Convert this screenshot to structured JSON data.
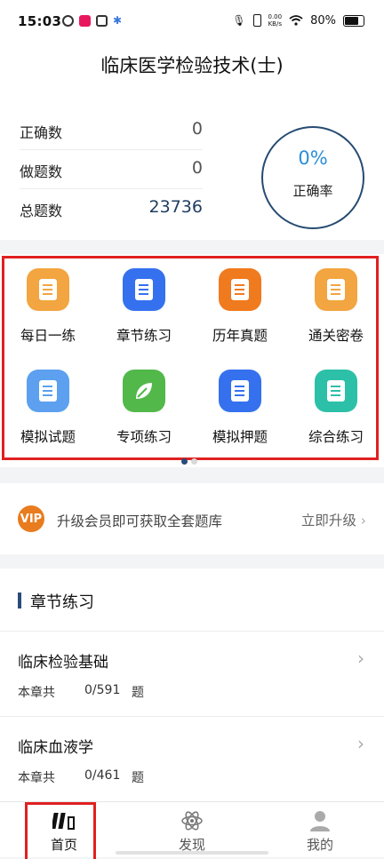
{
  "status_bar": {
    "time": "15:03",
    "net_speed_value": "0.00",
    "net_speed_unit": "KB/s",
    "battery": "80%"
  },
  "header": {
    "title": "临床医学检验技术(士)"
  },
  "stats": {
    "correct_label": "正确数",
    "correct_value": "0",
    "done_label": "做题数",
    "done_value": "0",
    "total_label": "总题数",
    "total_value": "23736",
    "rate_value": "0%",
    "rate_label": "正确率"
  },
  "menu": {
    "items": [
      {
        "label": "每日一练",
        "icon": "daily-practice-icon",
        "color": "#f2a540"
      },
      {
        "label": "章节练习",
        "icon": "chapter-practice-icon",
        "color": "#3571ee"
      },
      {
        "label": "历年真题",
        "icon": "past-exams-icon",
        "color": "#f07a1e"
      },
      {
        "label": "通关密卷",
        "icon": "secret-paper-icon",
        "color": "#f2a540"
      },
      {
        "label": "模拟试题",
        "icon": "mock-questions-icon",
        "color": "#5ca0ef"
      },
      {
        "label": "专项练习",
        "icon": "special-practice-icon",
        "color": "#52b84a"
      },
      {
        "label": "模拟押题",
        "icon": "mock-prediction-icon",
        "color": "#3571ee"
      },
      {
        "label": "综合练习",
        "icon": "comprehensive-practice-icon",
        "color": "#2dc0a8"
      }
    ]
  },
  "vip": {
    "badge": "VIP",
    "text": "升级会员即可获取全套题库",
    "action": "立即升级"
  },
  "chapter": {
    "title": "章节练习",
    "items": [
      {
        "name": "临床检验基础",
        "meta": "本章共",
        "progress": "0/591",
        "unit": "题"
      },
      {
        "name": "临床血液学",
        "meta": "本章共",
        "progress": "0/461",
        "unit": "题"
      }
    ]
  },
  "tabs": [
    {
      "label": "首页",
      "icon": "home-books-icon"
    },
    {
      "label": "发现",
      "icon": "discover-atom-icon"
    },
    {
      "label": "我的",
      "icon": "profile-icon"
    }
  ]
}
